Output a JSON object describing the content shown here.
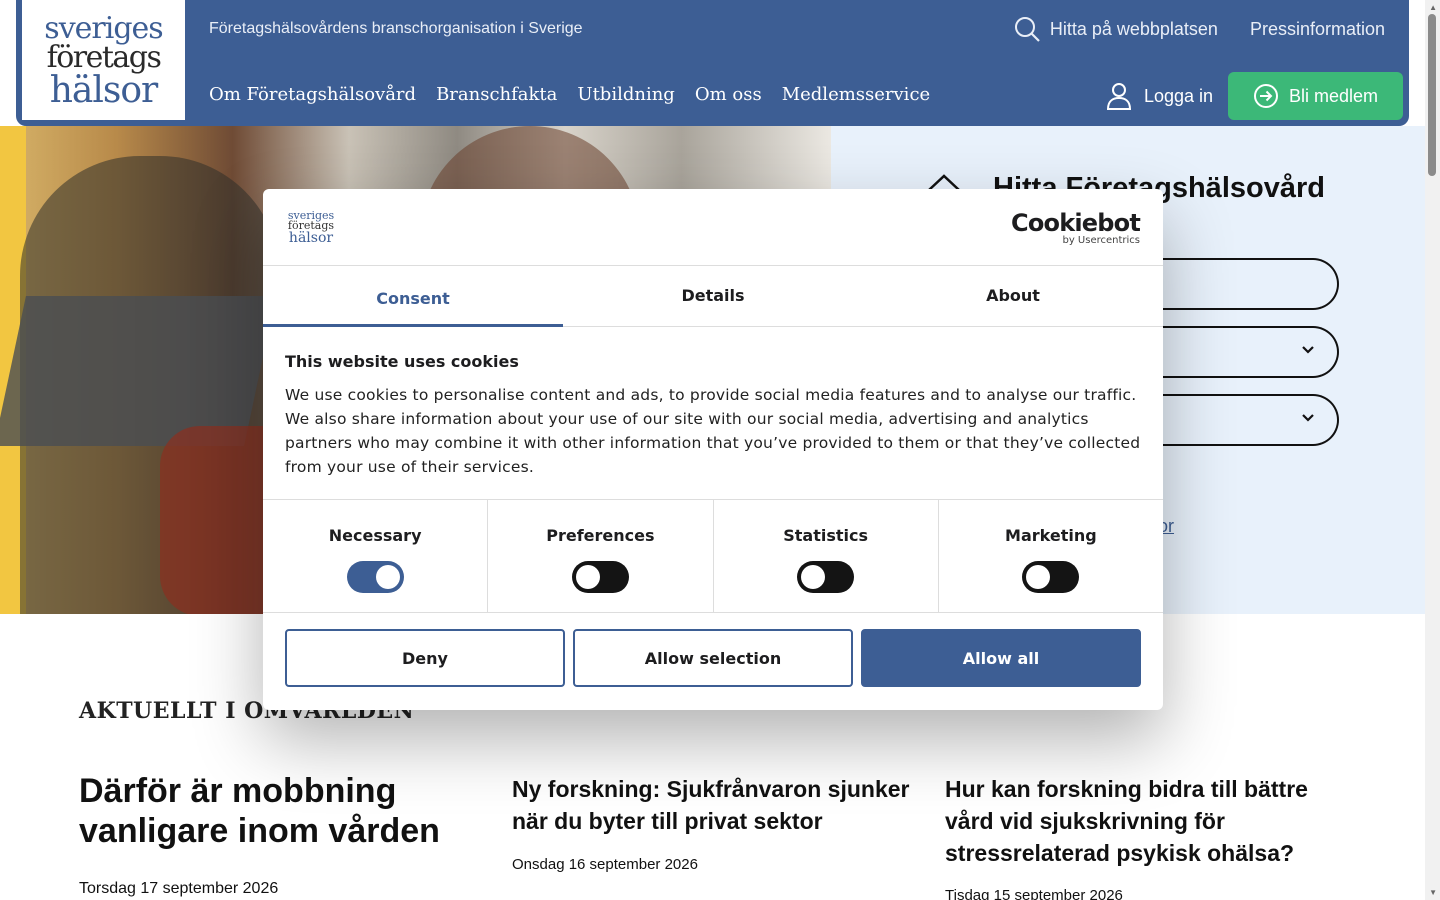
{
  "header": {
    "logo": {
      "line1": "sveriges",
      "line2": "företags",
      "line3": "hälsor"
    },
    "tagline": "Företagshälsovårdens branschorganisation i Sverige",
    "search_label": "Hitta på webbplatsen",
    "press_label": "Pressinformation",
    "nav": [
      "Om Företagshälsovård",
      "Branschfakta",
      "Utbildning",
      "Om oss",
      "Medlemsservice"
    ],
    "login_label": "Logga in",
    "join_label": "Bli medlem"
  },
  "hero": {
    "find_title": "Hitta Företagshälsovård",
    "link_text": "sor"
  },
  "news": {
    "section_title": "AKTUELLT I OMVÄRLDEN",
    "items": [
      {
        "title": "Därför är mobbning vanligare inom vården",
        "date": "Torsdag 17 september 2026"
      },
      {
        "title": "Ny forskning: Sjukfrånvaron sjunker när du byter till privat sektor",
        "date": "Onsdag 16 september 2026"
      },
      {
        "title": "Hur kan forskning bidra till bättre vård vid sjukskrivning för stressrelaterad psykisk ohälsa?",
        "date": "Tisdag 15 september 2026"
      }
    ]
  },
  "cookie": {
    "logo": {
      "line1": "sveriges",
      "line2": "företags",
      "line3": "hälsor"
    },
    "brand": "Cookiebot",
    "brand_sub": "by Usercentrics",
    "tabs": [
      "Consent",
      "Details",
      "About"
    ],
    "heading": "This website uses cookies",
    "body": "We use cookies to personalise content and ads, to provide social media features and to analyse our traffic. We also share information about your use of our site with our social media, advertising and analytics partners who may combine it with other information that you’ve provided to them or that they’ve collected from your use of their services.",
    "toggles": [
      {
        "label": "Necessary",
        "on": true
      },
      {
        "label": "Preferences",
        "on": false
      },
      {
        "label": "Statistics",
        "on": false
      },
      {
        "label": "Marketing",
        "on": false
      }
    ],
    "buttons": {
      "deny": "Deny",
      "selection": "Allow selection",
      "all": "Allow all"
    }
  },
  "colors": {
    "brand_blue": "#3d5e94",
    "join_green": "#3cb878",
    "hero_panel": "#e8f1fb"
  }
}
